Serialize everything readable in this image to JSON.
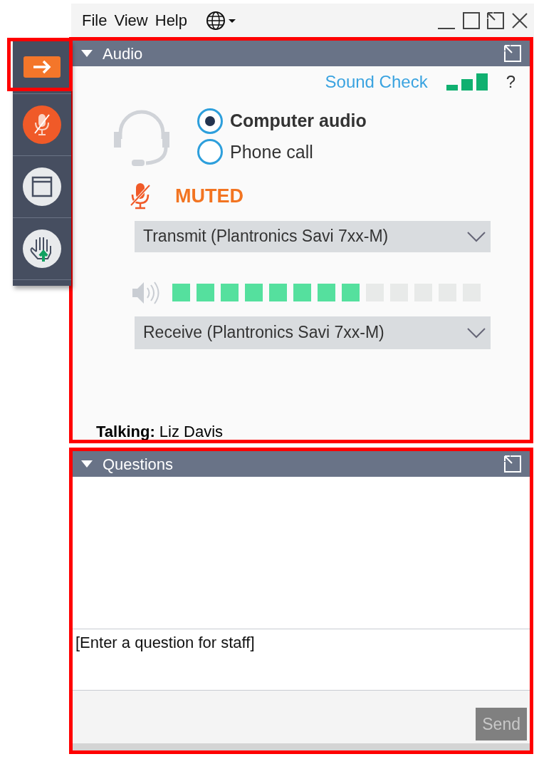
{
  "menu": [
    "File",
    "View",
    "Help"
  ],
  "sidebar": {
    "items": [
      {
        "kind": "arrow",
        "selected": true
      },
      {
        "kind": "mic"
      },
      {
        "kind": "window"
      },
      {
        "kind": "hand"
      }
    ]
  },
  "audio": {
    "title": "Audio",
    "sound_check": "Sound Check",
    "help": "?",
    "options": [
      {
        "label": "Computer audio",
        "selected": true
      },
      {
        "label": "Phone call",
        "selected": false
      }
    ],
    "muted": true,
    "mute_label": "MUTED",
    "transmit": "Transmit (Plantronics Savi 7xx-M)",
    "speaker": {
      "level": 0.615
    },
    "receive": "Receive (Plantronics Savi 7xx-M)",
    "talking_label": "Talking:",
    "talking_name": "Liz Davis"
  },
  "questions": {
    "title": "Questions",
    "placeholder": "[Enter a question for staff]",
    "send": {
      "label": "Send",
      "disabled": true
    }
  }
}
